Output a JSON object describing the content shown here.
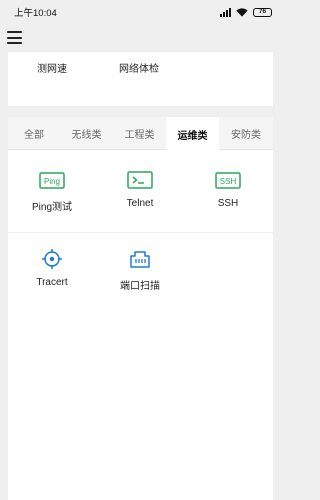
{
  "status_bar": {
    "time": "上午10:04",
    "battery": "76"
  },
  "top_card": {
    "items": [
      "测网速",
      "网络体检"
    ]
  },
  "tabs": {
    "items": [
      "全部",
      "无线类",
      "工程类",
      "运维类",
      "安防类"
    ],
    "active": "运维类"
  },
  "tools": [
    {
      "label": "Ping测试",
      "icon": "ping-icon",
      "icon_text": "Ping"
    },
    {
      "label": "Telnet",
      "icon": "terminal-icon"
    },
    {
      "label": "SSH",
      "icon": "ssh-icon",
      "icon_text": "SSH"
    },
    {
      "label": "Tracert",
      "icon": "crosshair-icon"
    },
    {
      "label": "端口扫描",
      "icon": "ethernet-port-icon"
    }
  ],
  "colors": {
    "green": "#2aa85c",
    "blue": "#1e7bd6",
    "active_tab": "#ffffff",
    "tab_bar": "#f5f5f5",
    "background": "#efefef"
  }
}
